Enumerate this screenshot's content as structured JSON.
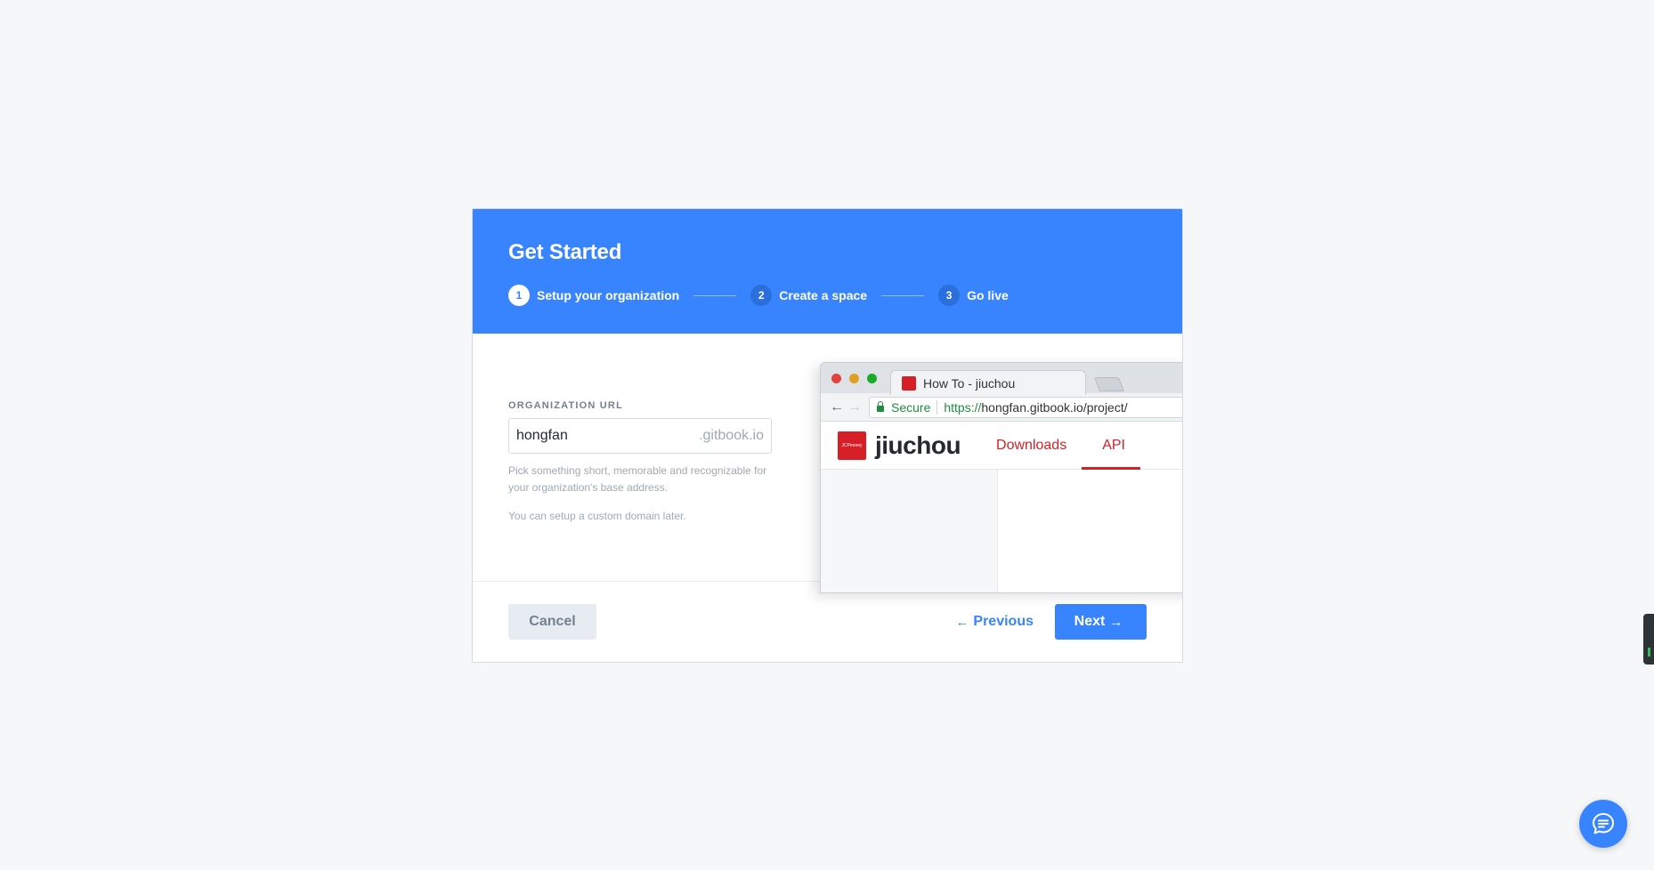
{
  "dialog": {
    "title": "Get Started",
    "steps": [
      {
        "num": "1",
        "label": "Setup your organization",
        "active": true
      },
      {
        "num": "2",
        "label": "Create a space",
        "active": false
      },
      {
        "num": "3",
        "label": "Go live",
        "active": false
      }
    ]
  },
  "form": {
    "label": "ORGANIZATION URL",
    "value": "hongfan",
    "suffix": ".gitbook.io",
    "help": "Pick something short, memorable and recognizable for your organization's base address.",
    "help2": "You can setup a custom domain later."
  },
  "preview": {
    "tab_title": "How To - jiuchou",
    "secure": "Secure",
    "url_scheme": "https://",
    "url_rest": "hongfan.gitbook.io/project/",
    "logo_text": "JCPenney",
    "site_name": "jiuchou",
    "links": [
      "Downloads",
      "API"
    ]
  },
  "footer": {
    "cancel": "Cancel",
    "previous": "Previous",
    "next": "Next"
  },
  "colors": {
    "primary": "#3884ff",
    "brand_red": "#d61f26"
  },
  "icons": {
    "chat": "chat-bubble-icon",
    "arrow_left": "arrow-left-icon",
    "arrow_right": "arrow-right-icon"
  }
}
